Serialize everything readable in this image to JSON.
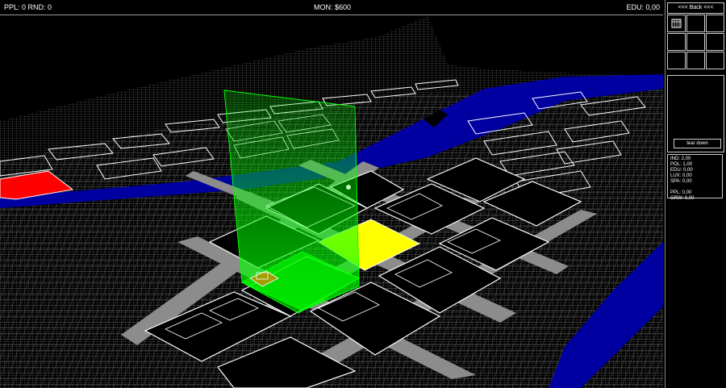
{
  "hud": {
    "left": "PPL: 0 RND: 0",
    "money": "MON: $600",
    "edu": "EDU: 0,00"
  },
  "panel": {
    "back_label": "<<< Back <<<",
    "tear_label": "tear down",
    "stats": [
      "IND: 2,00",
      "POL: 1,00",
      "EDU: 0,00",
      "LUX: 0,00",
      "SPA: 0,00",
      "",
      "PPL: 0,00",
      "GRW: 0,00"
    ],
    "grid_icon": "building-icon"
  },
  "colors": {
    "water": "#0000a0",
    "road": "#8c8c8c",
    "selected": "#ffff00",
    "highlight": "#00ff00",
    "alert": "#ff0000"
  }
}
